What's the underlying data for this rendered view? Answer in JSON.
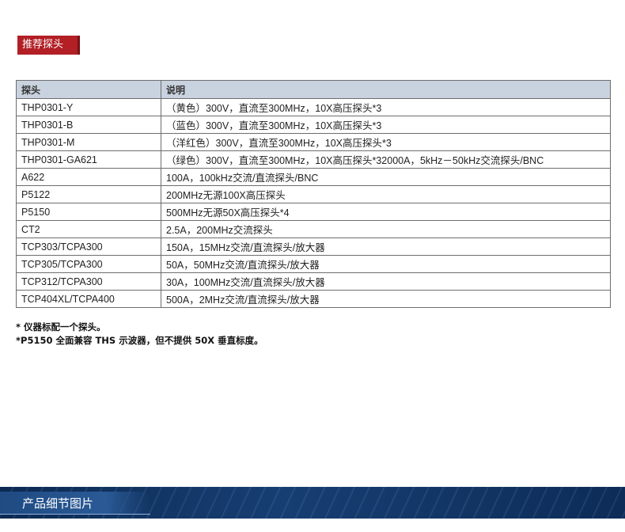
{
  "section": {
    "title": "推荐探头"
  },
  "table": {
    "headers": [
      "探头",
      "说明"
    ],
    "rows": [
      [
        "THP0301-Y",
        "（黄色）300V，直流至300MHz，10X高压探头*3"
      ],
      [
        "THP0301-B",
        "（蓝色）300V，直流至300MHz，10X高压探头*3"
      ],
      [
        "THP0301-M",
        "（洋红色）300V，直流至300MHz，10X高压探头*3"
      ],
      [
        "THP0301-GA621",
        "（绿色）300V，直流至300MHz，10X高压探头*32000A，5kHz－50kHz交流探头/BNC"
      ],
      [
        "A622",
        "100A，100kHz交流/直流探头/BNC"
      ],
      [
        "P5122",
        "200MHz无源100X高压探头"
      ],
      [
        "P5150",
        "500MHz无源50X高压探头*4"
      ],
      [
        "CT2",
        "2.5A，200MHz交流探头"
      ],
      [
        "TCP303/TCPA300",
        "150A，15MHz交流/直流探头/放大器"
      ],
      [
        "TCP305/TCPA300",
        "50A，50MHz交流/直流探头/放大器"
      ],
      [
        "TCP312/TCPA300",
        "30A，100MHz交流/直流探头/放大器"
      ],
      [
        "TCP404XL/TCPA400",
        "500A，2MHz交流/直流探头/放大器"
      ]
    ]
  },
  "notes": [
    "* 仪器标配一个探头。",
    "*P5150 全面兼容 THS 示波器，但不提供 50X 垂直标度。"
  ],
  "footer": {
    "title": "产品细节图片"
  }
}
